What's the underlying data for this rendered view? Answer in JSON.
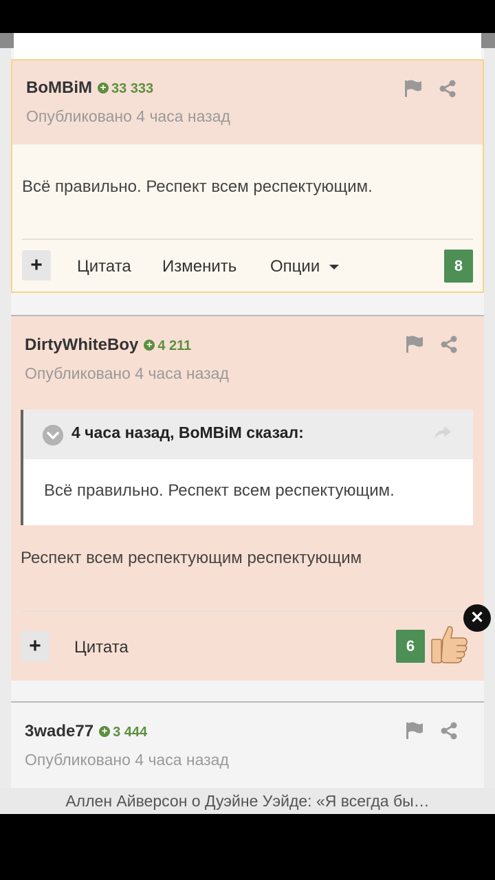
{
  "posts": [
    {
      "author": "BoMBiM",
      "reputation": "33 333",
      "published": "Опубликовано 4 часа назад",
      "content": "Всё правильно. Респект всем респектующим.",
      "actions": {
        "quote": "Цитата",
        "edit": "Изменить",
        "options": "Опции"
      },
      "likes": "8"
    },
    {
      "author": "DirtyWhiteBoy",
      "reputation": "4 211",
      "published": "Опубликовано 4 часа назад",
      "quote": {
        "header": "4 часа назад, BoMBiM сказал:",
        "text": "Всё правильно. Респект всем респектующим."
      },
      "content": "Респект всем респектующим респектующим",
      "actions": {
        "quote": "Цитата"
      },
      "likes": "6"
    },
    {
      "author": "3wade77",
      "reputation": "3 444",
      "published": "Опубликовано 4 часа назад"
    }
  ],
  "banner": "Аллен Айверсон о Дуэйне Уэйде: «Я всегда бы…",
  "colors": {
    "accent_green": "#4d8f55",
    "rep_green": "#5c8f3e",
    "highlight_border": "#f6d58a"
  },
  "icons": [
    "flag-icon",
    "share-icon",
    "chevron-down-icon",
    "reply-icon",
    "close-icon",
    "thumbs-up-icon"
  ]
}
